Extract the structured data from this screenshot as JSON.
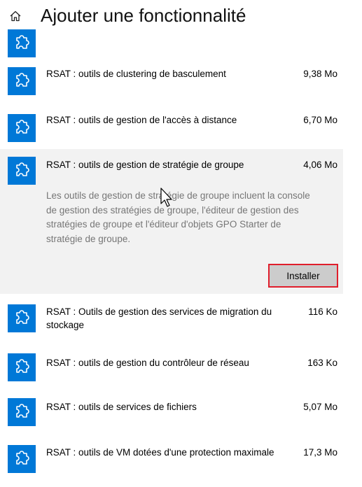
{
  "header": {
    "title": "Ajouter une fonctionnalité"
  },
  "features": [
    {
      "name": "",
      "size": ""
    },
    {
      "name": "RSAT : outils de clustering de basculement",
      "size": "9,38 Mo"
    },
    {
      "name": "RSAT : outils de gestion de l'accès à distance",
      "size": "6,70 Mo"
    },
    {
      "name": "RSAT : outils de gestion de stratégie de groupe",
      "size": "4,06 Mo",
      "description": "Les outils de gestion de stratégie de groupe incluent la console de gestion des stratégies de groupe, l'éditeur de gestion des stratégies de groupe et l'éditeur d'objets GPO Starter de stratégie de groupe.",
      "install_label": "Installer"
    },
    {
      "name": "RSAT : Outils de gestion des services de migration du stockage",
      "size": "116 Ko"
    },
    {
      "name": "RSAT : outils de gestion du contrôleur de réseau",
      "size": "163 Ko"
    },
    {
      "name": "RSAT : outils de services de fichiers",
      "size": "5,07 Mo"
    },
    {
      "name": "RSAT : outils de VM dotées d'une protection maximale",
      "size": "17,3 Mo"
    }
  ],
  "icons": {
    "home": "home-icon",
    "feature": "puzzle-icon",
    "pointer": "mouse-cursor"
  },
  "colors": {
    "tile": "#0078d7",
    "expanded_bg": "#f2f2f2",
    "button_bg": "#cccccc",
    "highlight_border": "#e01e2c",
    "description_text": "#767676"
  }
}
